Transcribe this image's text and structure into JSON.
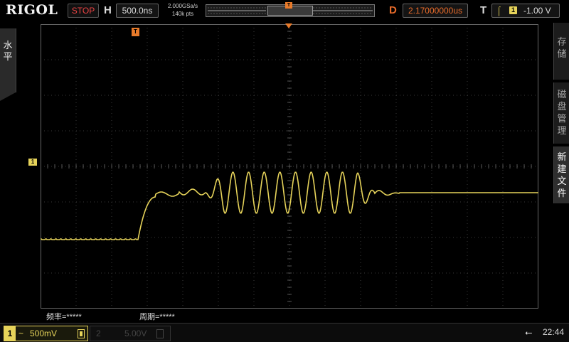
{
  "header": {
    "brand": "RIGOL",
    "run_status": "STOP",
    "horizontal_label": "H",
    "timebase": "500.0ns",
    "sample_rate": "2.000GSa/s",
    "memory_depth": "140k pts",
    "delay_label": "D",
    "delay": "2.17000000us",
    "trigger_label": "T",
    "trigger_source": "1",
    "trigger_level": "-1.00 V",
    "trigger_marker": "T"
  },
  "left_tab": {
    "label": "水平"
  },
  "right_menu": {
    "items": [
      {
        "label": "存储",
        "active": false
      },
      {
        "label": "磁盘管理",
        "active": false
      },
      {
        "label": "新建文件",
        "active": true
      }
    ]
  },
  "screen": {
    "ch1_marker": "1",
    "trigger_position_marker": "T"
  },
  "measurements": {
    "frequency": "频率=*****",
    "period": "周期=*****"
  },
  "channels": [
    {
      "number": "1",
      "coupling": "~",
      "scale": "500mV",
      "active": true,
      "color": "#e6d35a"
    },
    {
      "number": "2",
      "coupling": "~",
      "scale": "5.00V",
      "active": false,
      "color": "#444444"
    }
  ],
  "status": {
    "time": "22:44",
    "usb_icon": "usb-icon"
  },
  "colors": {
    "ch1": "#e6d35a",
    "trigger": "#e87a2a",
    "stop": "#ee4444",
    "grid": "#3a3a3a"
  }
}
